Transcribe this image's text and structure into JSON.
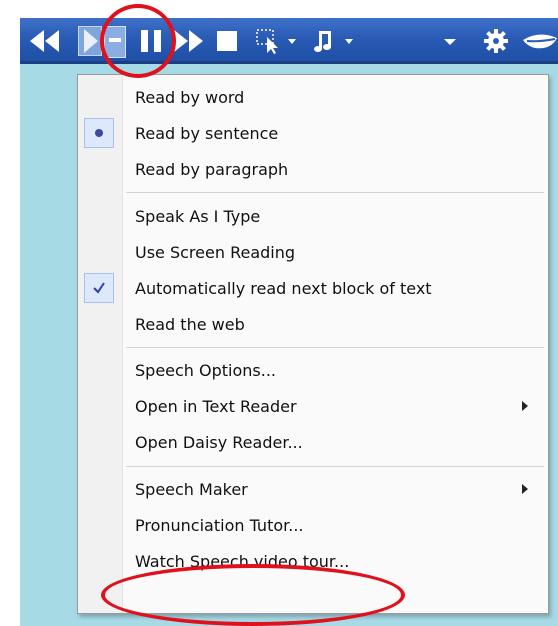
{
  "colors": {
    "toolbar": "#2a5cb6",
    "desktop": "#a6dbe6",
    "highlight": "#e0101c",
    "menu_bg": "#fafafa"
  },
  "toolbar": {
    "icons": [
      "rewind-icon",
      "play-icon",
      "dropdown-arrow-icon",
      "pause-icon",
      "fast-forward-icon",
      "stop-icon",
      "selection-icon",
      "music-note-icon",
      "settings-gear-icon",
      "mouth-icon"
    ]
  },
  "menu": {
    "groups": [
      [
        {
          "label": "Read by word"
        },
        {
          "label": "Read by sentence",
          "mark": "radio"
        },
        {
          "label": "Read by paragraph"
        }
      ],
      [
        {
          "label": "Speak As I Type"
        },
        {
          "label": "Use Screen Reading"
        },
        {
          "label": "Automatically read next block of text",
          "mark": "check"
        },
        {
          "label": "Read the web"
        }
      ],
      [
        {
          "label": "Speech Options..."
        },
        {
          "label": "Open in Text Reader",
          "submenu": true
        },
        {
          "label": "Open Daisy Reader..."
        }
      ],
      [
        {
          "label": "Speech Maker",
          "submenu": true
        },
        {
          "label": "Pronunciation Tutor..."
        },
        {
          "label": "Watch Speech video tour..."
        }
      ]
    ]
  }
}
